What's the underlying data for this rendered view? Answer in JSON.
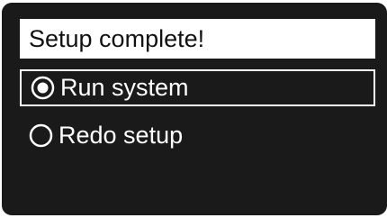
{
  "header": {
    "title": "Setup complete!"
  },
  "options": [
    {
      "label": "Run system",
      "selected": true
    },
    {
      "label": "Redo setup",
      "selected": false
    }
  ],
  "colors": {
    "screen_background": "#1a1a1a",
    "foreground": "#ffffff",
    "title_text": "#111111"
  },
  "icons": {
    "selected_radio": "radio-selected-icon",
    "unselected_radio": "radio-unselected-icon"
  }
}
